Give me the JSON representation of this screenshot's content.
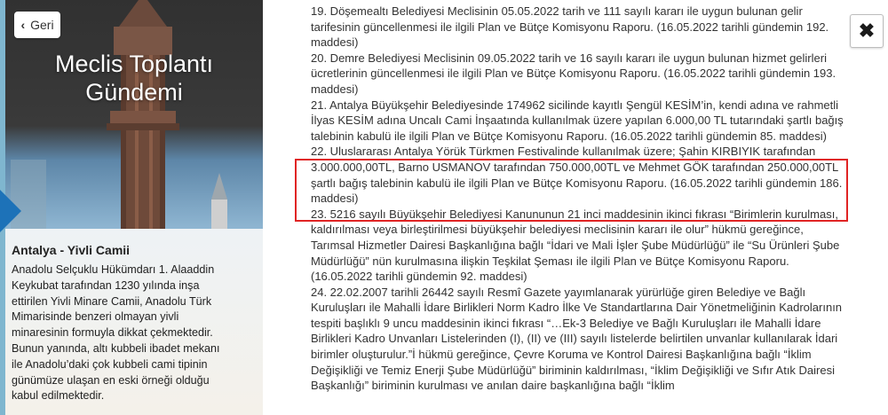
{
  "left_panel": {
    "back_label": "Geri",
    "title_line1": "Meclis Toplantı",
    "title_line2": "Gündemi",
    "place_title": "Antalya - Yivli Camii",
    "place_description": "Anadolu Selçuklu Hükümdarı 1. Alaaddin Keykubat tarafından 1230 yılında inşa ettirilen Yivli Minare Camii, Anadolu Türk Mimarisinde benzeri olmayan yivli minaresinin formuyla dikkat çekmektedir. Bunun yanında, altı kubbeli ibadet mekanı ile Anadolu’daki çok kubbeli cami tipinin günümüze ulaşan en eski örneği olduğu kabul edilmektedir."
  },
  "close_icon": "close-icon",
  "agenda_items": [
    {
      "text": "19. Döşemealtı Belediyesi Meclisinin 05.05.2022 tarih ve 111 sayılı kararı ile uygun bulunan gelir tarifesinin güncellenmesi  ile ilgili Plan ve Bütçe Komisyonu Raporu. (16.05.2022 tarihli gündemin 192. maddesi)"
    },
    {
      "text": "20. Demre Belediyesi Meclisinin 09.05.2022 tarih ve 16 sayılı kararı ile uygun bulunan hizmet gelirleri ücretlerinin güncellenmesi ile ilgili Plan ve Bütçe Komisyonu Raporu. (16.05.2022 tarihli gündemin 193. maddesi)"
    },
    {
      "text": "21. Antalya Büyükşehir Belediyesinde 174962 sicilinde kayıtlı Şengül KESİM’in, kendi adına ve rahmetli İlyas KESİM adına Uncalı Cami İnşaatında kullanılmak üzere yapılan 6.000,00 TL tutarındaki şartlı bağış talebinin kabulü ile ilgili Plan ve Bütçe Komisyonu Raporu. (16.05.2022 tarihli gündemin 85. maddesi)"
    },
    {
      "text": "22. Uluslararası Antalya Yörük Türkmen Festivalinde kullanılmak üzere; Şahin KIRBIYIK tarafından 3.000.000,00TL, Barno USMANOV tarafından 750.000,00TL ve Mehmet GÖK tarafından 250.000,00TL şartlı bağış talebinin kabulü ile ilgili Plan ve Bütçe Komisyonu Raporu. (16.05.2022 tarihli gündemin 186. maddesi)"
    },
    {
      "text": "23. 5216 sayılı Büyükşehir Belediyesi Kanununun 21 inci maddesinin ikinci fıkrası “Birimlerin kurulması, kaldırılması veya birleştirilmesi büyükşehir belediyesi meclisinin kararı ile olur” hükmü gereğince, Tarımsal Hizmetler Dairesi Başkanlığına bağlı “İdari ve Mali İşler Şube Müdürlüğü” ile “Su Ürünleri Şube Müdürlüğü” nün kurulmasına ilişkin Teşkilat Şeması ile ilgili Plan ve Bütçe Komisyonu Raporu. (16.05.2022 tarihli gündemin 92. maddesi)"
    },
    {
      "text": "24. 22.02.2007 tarihli 26442 sayılı Resmî Gazete yayımlanarak yürürlüğe giren Belediye ve Bağlı Kuruluşları ile Mahalli İdare Birlikleri Norm Kadro İlke Ve Standartlarına Dair Yönetmeliğinin Kadrolarının tespiti başlıklı 9 uncu maddesinin ikinci fıkrası “…Ek-3 Belediye ve Bağlı Kuruluşları ile Mahalli İdare Birlikleri Kadro Unvanları Listelerinden (I), (II) ve (III) sayılı listelerde belirtilen unvanlar kullanılarak İdari birimler oluşturulur.”İ hükmü gereğince, Çevre Koruma ve Kontrol Dairesi Başkanlığına bağlı “İklim Değişikliği ve Temiz Enerji Şube Müdürlüğü” biriminin kaldırılması, “İklim Değişikliği ve Sıfır Atık Dairesi Başkanlığı” biriminin kurulması ve anılan daire başkanlığına bağlı “İklim"
    }
  ],
  "colors": {
    "highlight": "#e02424",
    "accent": "#1d72b8"
  }
}
